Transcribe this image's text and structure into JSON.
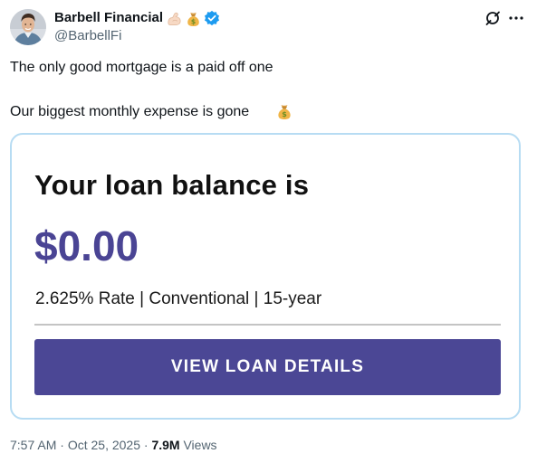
{
  "author": {
    "name": "Barbell Financial",
    "handle": "@BarbellFi",
    "verified": true,
    "name_emojis": [
      "flexed-biceps-icon",
      "money-bag-icon"
    ],
    "verified_color": "#1d9bf0"
  },
  "tweet": {
    "line1": "The only good mortgage is a paid off one",
    "line2": "Our biggest monthly expense is gone",
    "line2_emoji": "money-bag-icon"
  },
  "card": {
    "heading": "Your loan balance is",
    "amount": "$0.00",
    "details": "2.625% Rate | Conventional | 15-year",
    "button_label": "VIEW LOAN DETAILS",
    "accent_color": "#4b4795",
    "border_color": "#b7dcf3"
  },
  "meta": {
    "time": "7:57 AM",
    "separator": "·",
    "date": "Oct 25, 2025",
    "views_count": "7.9M",
    "views_label": "Views"
  },
  "icons": {
    "grok": "grok-icon",
    "more": "more-options-icon"
  }
}
